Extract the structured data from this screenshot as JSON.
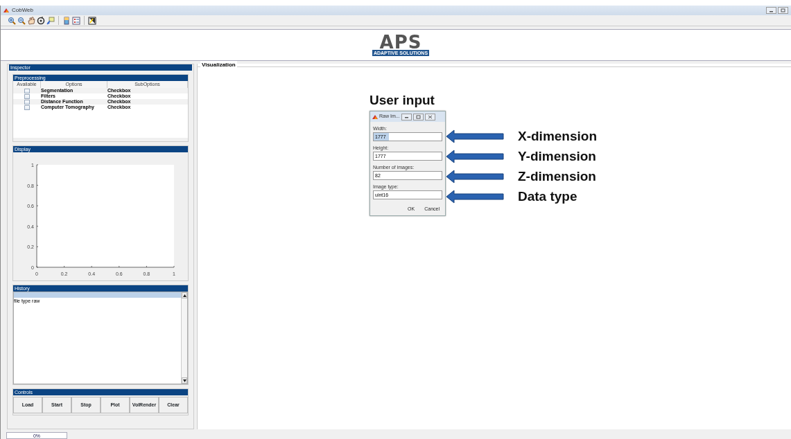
{
  "window": {
    "title": "CobWeb"
  },
  "logo": {
    "text": "APS",
    "tagline": "ADAPTIVE SOLUTIONS"
  },
  "inspector": {
    "title": "Inspector",
    "preprocessing": {
      "title": "Preprocessing",
      "columns": [
        "Available",
        "Options",
        "SubOptions"
      ],
      "rows": [
        {
          "checked": false,
          "option": "Segmentation",
          "suboption": "Checkbox"
        },
        {
          "checked": false,
          "option": "Filters",
          "suboption": "Checkbox"
        },
        {
          "checked": false,
          "option": "Distance Function",
          "suboption": "Checkbox"
        },
        {
          "checked": false,
          "option": "Computer Tomography",
          "suboption": "Checkbox"
        }
      ]
    },
    "display": {
      "title": "Display",
      "chart_data": {
        "type": "line",
        "xlim": [
          0,
          1
        ],
        "ylim": [
          0,
          1
        ],
        "xticks": [
          0,
          0.2,
          0.4,
          0.6,
          0.8,
          1
        ],
        "yticks": [
          0,
          0.2,
          0.4,
          0.6,
          0.8,
          1
        ]
      }
    },
    "history": {
      "title": "History",
      "entries": [
        "file type raw"
      ]
    },
    "controls": {
      "title": "Controls",
      "buttons": [
        "Load",
        "Start",
        "Stop",
        "Plot",
        "VolRender",
        "Clear"
      ]
    }
  },
  "visualization": {
    "title": "Visualization",
    "heading": "User input",
    "dialog": {
      "title": "Raw Im...",
      "fields": [
        {
          "label": "Width:",
          "value": "1777",
          "selected": true
        },
        {
          "label": "Height:",
          "value": "1777",
          "selected": false
        },
        {
          "label": "Number of images:",
          "value": "82",
          "selected": false
        },
        {
          "label": "Image type:",
          "value": "uint16",
          "selected": false
        }
      ],
      "buttons": [
        "OK",
        "Cancel"
      ]
    },
    "annotations": [
      "X-dimension",
      "Y-dimension",
      "Z-dimension",
      "Data type"
    ]
  },
  "status_bar": {
    "progress": {
      "text": "0%"
    }
  }
}
